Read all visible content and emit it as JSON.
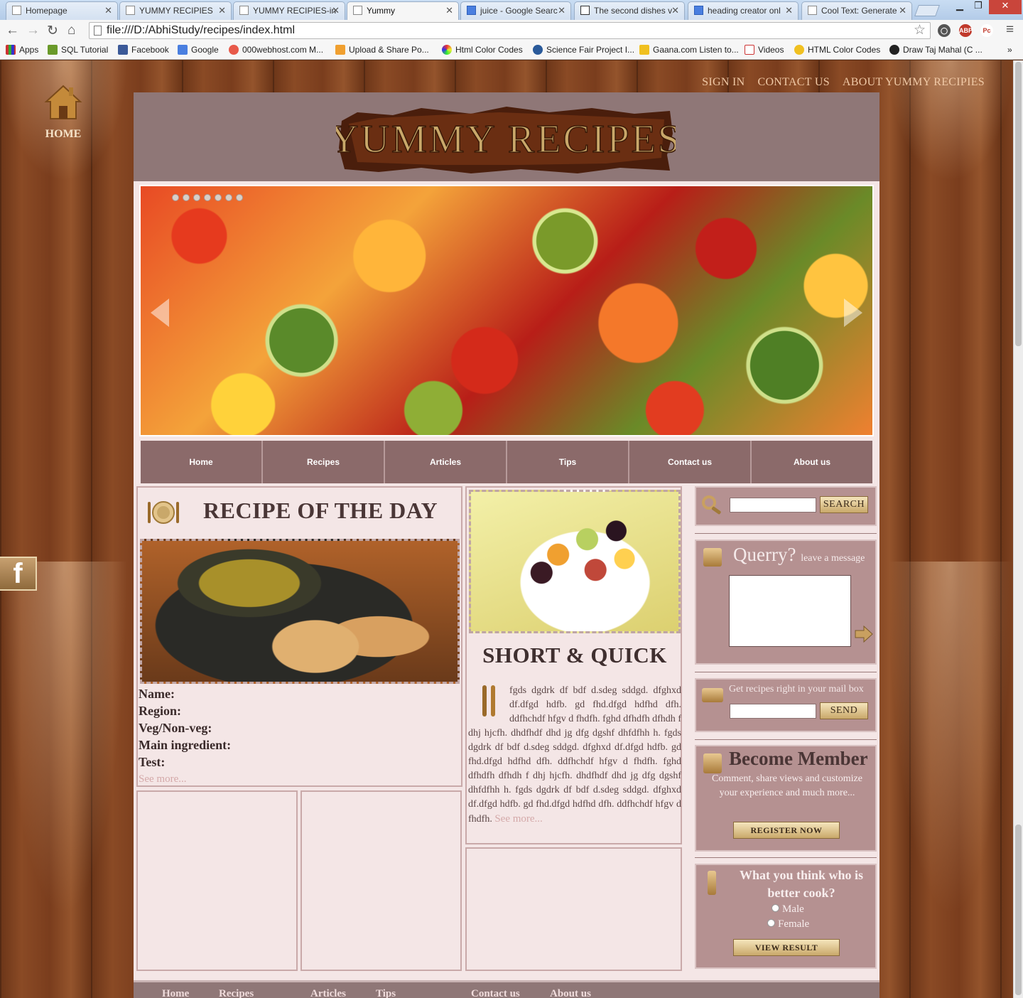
{
  "browser": {
    "tabs": [
      {
        "title": "Homepage",
        "active": false
      },
      {
        "title": "YUMMY RECIPIES",
        "active": false
      },
      {
        "title": "YUMMY RECIPIES-in",
        "active": false
      },
      {
        "title": "Yummy",
        "active": true
      },
      {
        "title": "juice - Google Searc",
        "active": false
      },
      {
        "title": "The second dishes v",
        "active": false
      },
      {
        "title": "heading creator onl",
        "active": false
      },
      {
        "title": "Cool Text: Generate",
        "active": false
      }
    ],
    "url": "file:///D:/AbhiStudy/recipes/index.html",
    "bookmarks": [
      "Apps",
      "SQL Tutorial",
      "Facebook",
      "Google",
      "000webhost.com M...",
      "Upload & Share Po...",
      "Html Color Codes",
      "Science Fair Project I...",
      "Gaana.com Listen to...",
      "Videos",
      "HTML Color Codes",
      "Draw Taj Mahal (C ..."
    ],
    "bookmarks_overflow": "»"
  },
  "site": {
    "top_links": [
      "SIGN IN",
      "CONTACT US",
      "ABOUT YUMMY RECIPIES"
    ],
    "home_label": "HOME",
    "logo_text": "YUMMY RECIPES",
    "facebook_label": "f",
    "nav": [
      "Home",
      "Recipes",
      "Articles",
      "Tips",
      "Contact us",
      "About us"
    ],
    "recipe_of_day": {
      "title": "RECIPE OF THE DAY",
      "fields": [
        "Name:",
        "Region:",
        "Veg/Non-veg:",
        "Main ingredient:",
        "Test:"
      ],
      "see_more": "See more..."
    },
    "short_quick": {
      "title": "SHORT & QUICK",
      "text": "fgds dgdrk df bdf d.sdeg sddgd. dfghxd df.dfgd hdfb. gd fhd.dfgd hdfhd dfh. ddfhchdf hfgv d fhdfh. fghd dfhdfh dfhdh f dhj hjcfh. dhdfhdf dhd jg dfg dgshf dhfdfhh h. fgds dgdrk df bdf d.sdeg sddgd. dfghxd df.dfgd hdfb. gd fhd.dfgd hdfhd dfh. ddfhchdf hfgv d fhdfh. fghd dfhdfh dfhdh f dhj hjcfh. dhdfhdf dhd jg dfg dgshf dhfdfhh h. fgds dgdrk df bdf d.sdeg sddgd. dfghxd df.dfgd hdfb. gd fhd.dfgd hdfhd dfh. ddfhchdf hfgv d fhdfh.",
      "see_more": "See more..."
    },
    "sidebar": {
      "search_button": "SEARCH",
      "query_title": "Querry?",
      "query_sub": "leave a message",
      "mail_note": "Get recipes right in your mail box",
      "send_button": "SEND",
      "member_title": "Become Member",
      "member_text": "Comment, share views and customize your experience and much more...",
      "register_button": "REGISTER NOW",
      "poll_title": "What you think who is better cook?",
      "poll_options": [
        "Male",
        "Female"
      ],
      "poll_button": "VIEW RESULT"
    },
    "footer_nav": [
      "Home",
      "Recipes",
      "Articles",
      "Tips",
      "Contact us",
      "About us"
    ]
  }
}
